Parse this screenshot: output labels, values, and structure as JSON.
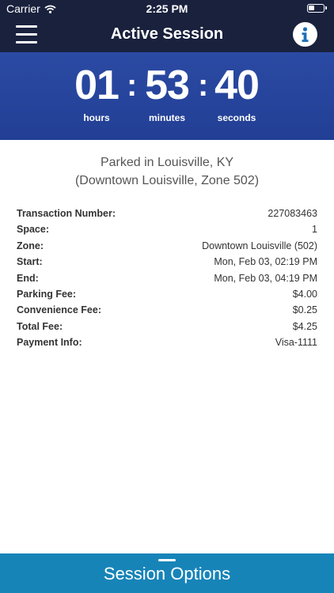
{
  "status_bar": {
    "carrier": "Carrier",
    "time": "2:25 PM"
  },
  "nav": {
    "title": "Active Session"
  },
  "timer": {
    "hours": "01",
    "minutes": "53",
    "seconds": "40",
    "hours_label": "hours",
    "minutes_label": "minutes",
    "seconds_label": "seconds"
  },
  "location": {
    "line1": "Parked in Louisville, KY",
    "line2": "(Downtown Louisville, Zone 502)"
  },
  "details": [
    {
      "label": "Transaction Number:",
      "value": "227083463"
    },
    {
      "label": "Space:",
      "value": "1"
    },
    {
      "label": "Zone:",
      "value": "Downtown Louisville (502)"
    },
    {
      "label": "Start:",
      "value": "Mon, Feb 03, 02:19 PM"
    },
    {
      "label": "End:",
      "value": "Mon, Feb 03, 04:19 PM"
    },
    {
      "label": "Parking Fee:",
      "value": "$4.00"
    },
    {
      "label": "Convenience Fee:",
      "value": "$0.25"
    },
    {
      "label": "Total Fee:",
      "value": "$4.25"
    },
    {
      "label": "Payment Info:",
      "value": "Visa-1111"
    }
  ],
  "bottom_bar": {
    "label": "Session Options"
  },
  "colors": {
    "nav_background": "#19213d",
    "timer_background": "#2b4aa3",
    "bottom_bar": "#1784b8"
  },
  "icons": {
    "menu": "hamburger-icon",
    "info": "info-icon",
    "wifi": "wifi-icon",
    "battery": "battery-icon"
  }
}
